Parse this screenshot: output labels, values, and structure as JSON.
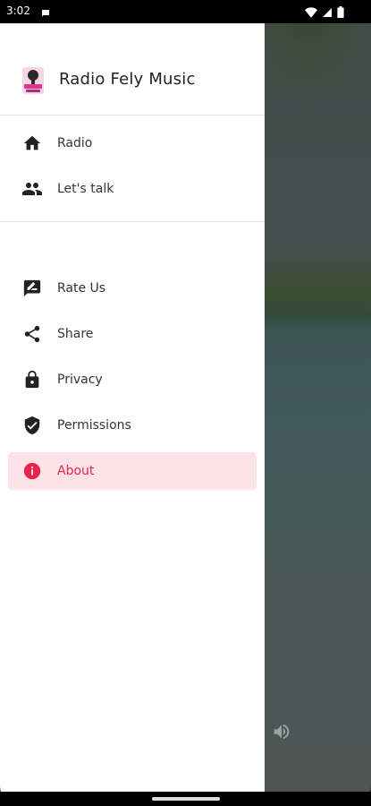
{
  "status_bar": {
    "time": "3:02",
    "icons": [
      "chat-bubble-icon",
      "wifi-icon",
      "signal-icon",
      "battery-icon"
    ]
  },
  "drawer": {
    "app_title": "Radio Fely Music",
    "logo": "radio-fely-logo",
    "primary_items": [
      {
        "label": "Radio",
        "icon": "home-icon"
      },
      {
        "label": "Let's talk",
        "icon": "people-icon"
      }
    ],
    "secondary_items": [
      {
        "label": "Rate Us",
        "icon": "rate-icon"
      },
      {
        "label": "Share",
        "icon": "share-icon"
      },
      {
        "label": "Privacy",
        "icon": "lock-icon"
      },
      {
        "label": "Permissions",
        "icon": "shield-check-icon"
      },
      {
        "label": "About",
        "icon": "info-icon",
        "selected": true
      }
    ]
  },
  "background": {
    "volume_icon": "volume-icon"
  },
  "colors": {
    "accent": "#e8244b",
    "selected_bg": "#fde3e8",
    "icon": "#222222"
  }
}
